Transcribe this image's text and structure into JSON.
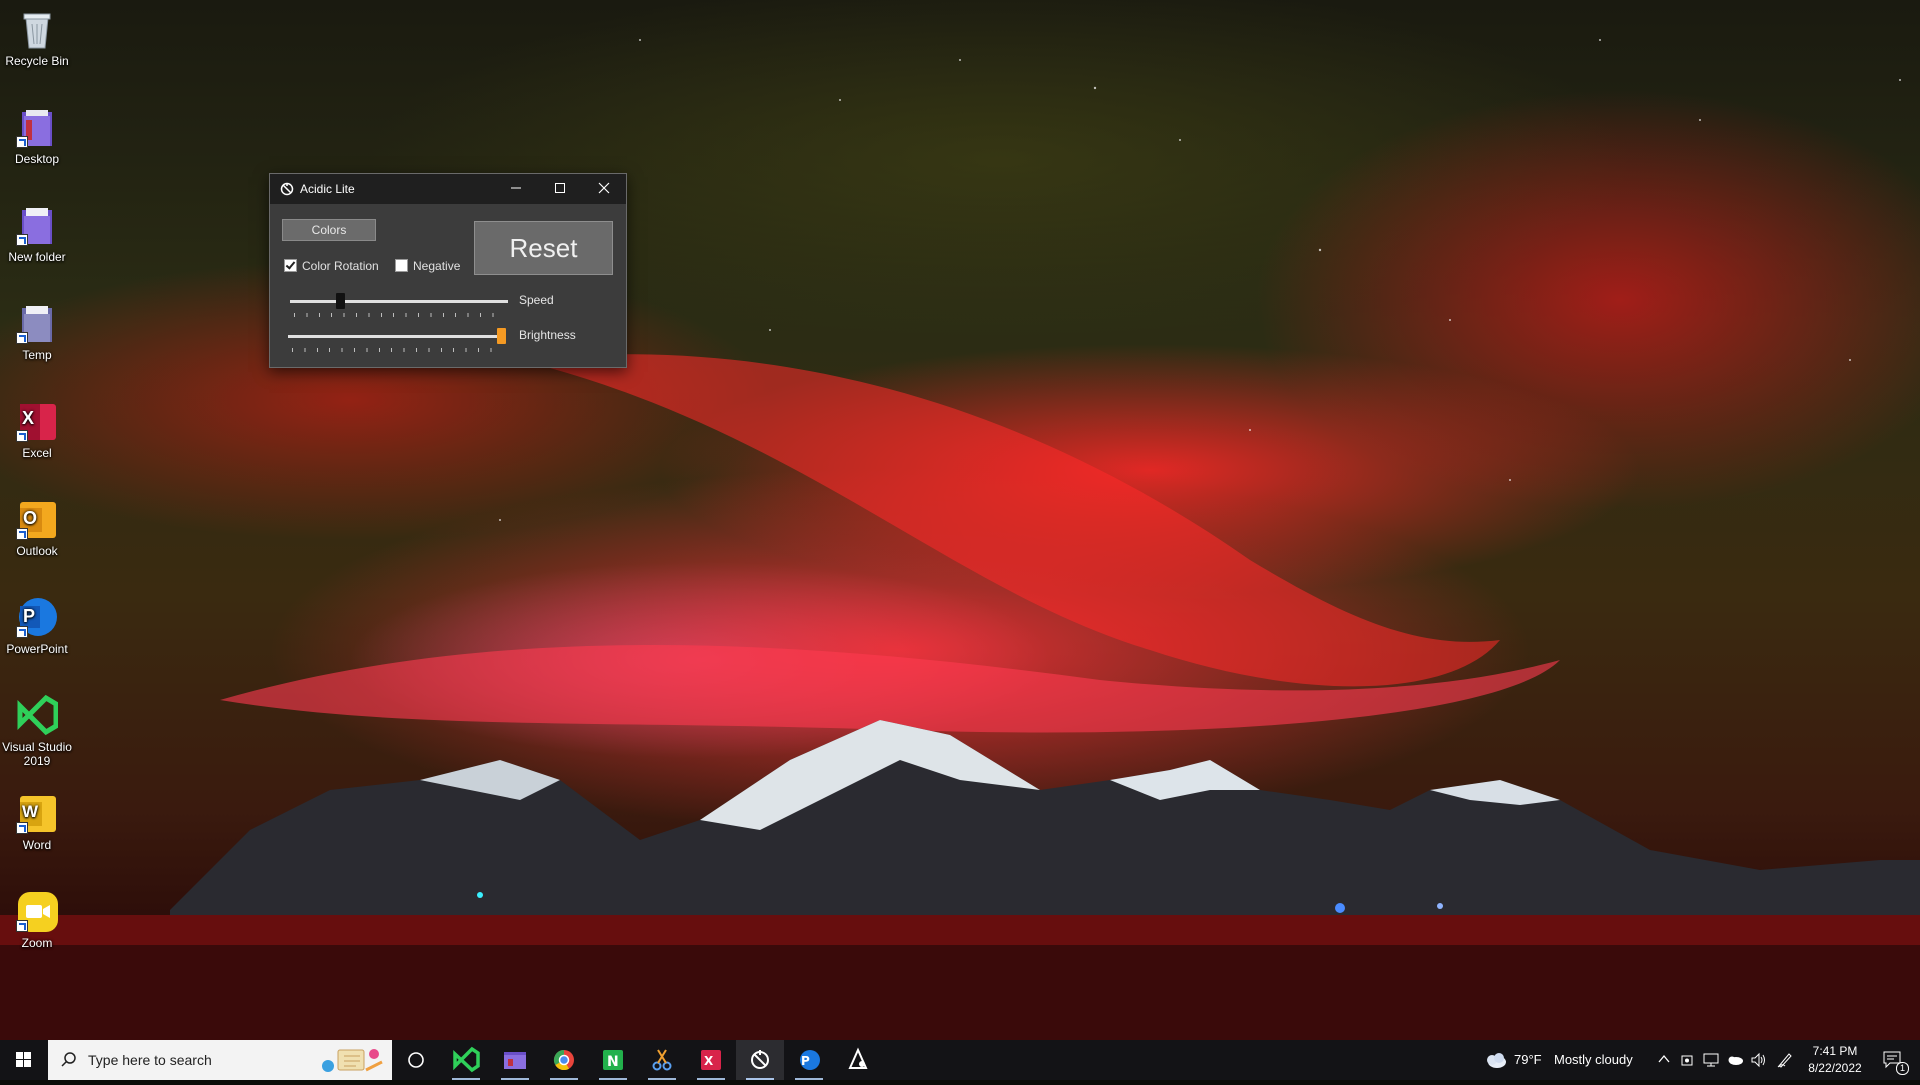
{
  "desktop": {
    "icons": [
      {
        "label": "Recycle Bin",
        "icon": "recycle-bin-icon"
      },
      {
        "label": "Desktop",
        "icon": "folder-icon"
      },
      {
        "label": "New folder",
        "icon": "folder-icon"
      },
      {
        "label": "Temp",
        "icon": "folder-icon"
      },
      {
        "label": "Excel",
        "icon": "excel-icon",
        "glyph": "X"
      },
      {
        "label": "Outlook",
        "icon": "outlook-icon",
        "glyph": "O"
      },
      {
        "label": "PowerPoint",
        "icon": "powerpoint-icon",
        "glyph": "P"
      },
      {
        "label": "Visual Studio 2019",
        "icon": "visual-studio-icon"
      },
      {
        "label": "Word",
        "icon": "word-icon",
        "glyph": "W"
      },
      {
        "label": "Zoom",
        "icon": "zoom-icon"
      }
    ]
  },
  "window": {
    "title": "Acidic Lite",
    "icon": "acidic-app-icon",
    "colors_button": "Colors",
    "reset_button": "Reset",
    "color_rotation": {
      "label": "Color Rotation",
      "checked": true
    },
    "negative": {
      "label": "Negative",
      "checked": false
    },
    "speed": {
      "label": "Speed",
      "value_fraction": 0.22
    },
    "brightness": {
      "label": "Brightness",
      "value_fraction": 1.0
    }
  },
  "taskbar": {
    "search_placeholder": "Type here to search",
    "apps": [
      "cortana-icon",
      "visual-studio-icon",
      "file-explorer-icon",
      "chrome-icon",
      "numbers-icon",
      "snipping-tool-icon",
      "excel-icon",
      "acidic-app-icon",
      "powerpoint-icon",
      "acidic-alt-icon"
    ],
    "weather": {
      "temp": "79°F",
      "condition": "Mostly cloudy"
    },
    "clock": {
      "time": "7:41 PM",
      "date": "8/22/2022"
    },
    "notifications_count": "1"
  },
  "colors": {
    "accent_orange": "#f59a23",
    "taskbar_bg": "#131316",
    "window_bg": "#3c3c3c"
  }
}
